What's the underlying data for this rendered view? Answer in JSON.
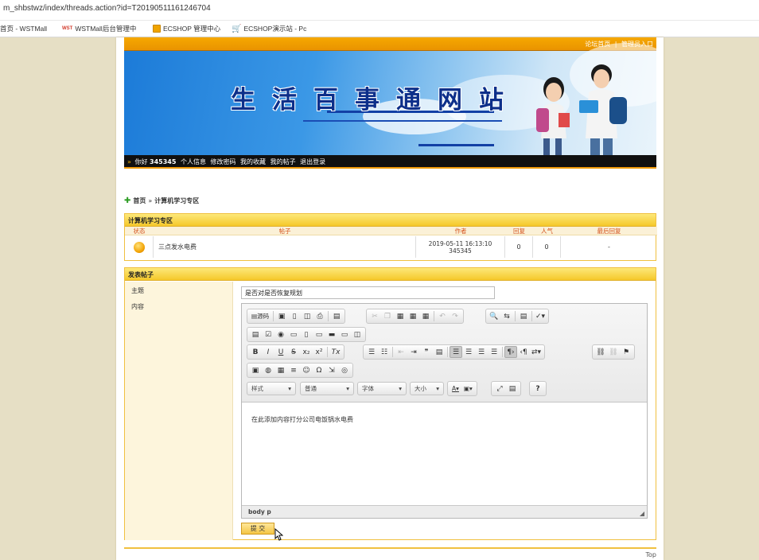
{
  "browser": {
    "url": "m_shbstwz/index/threads.action?id=T20190511161246704",
    "bookmarks": [
      {
        "label": "首页 - WSTMall",
        "icon": "page-icon"
      },
      {
        "label": "WSTMall后台管理中",
        "icon": "wst-logo-icon",
        "badge": "WST"
      },
      {
        "label": "ECSHOP 管理中心",
        "icon": "ecshop-icon"
      },
      {
        "label": "ECSHOP演示站 - Pc",
        "icon": "ecshop-cart-icon"
      }
    ]
  },
  "header": {
    "links": [
      "论坛首页",
      "管理员入口"
    ],
    "link_sep": "|",
    "site_title": "生活百事通网站"
  },
  "userbar": {
    "arrow": "»",
    "greeting": "你好",
    "username": "345345",
    "links": [
      "个人信息",
      "修改密码",
      "我的收藏",
      "我的帖子",
      "退出登录"
    ]
  },
  "breadcrumb": {
    "icon": "plus-icon",
    "home": "首页",
    "sep": "»",
    "current": "计算机学习专区"
  },
  "forum": {
    "title": "计算机学习专区",
    "columns": [
      "状态",
      "帖子",
      "作者",
      "回复",
      "人气",
      "最后回复"
    ],
    "threads": [
      {
        "title": "三点发水电费",
        "date": "2019-05-11 16:13:10",
        "author": "345345",
        "replies": "0",
        "views": "0",
        "last_reply": "-"
      }
    ]
  },
  "post_form": {
    "title": "发表帖子",
    "subject_label": "主题",
    "content_label": "内容",
    "subject_value": "是否对是否恢复规划",
    "toolbar": {
      "source_label": "源码",
      "format_options": {
        "styles": "样式",
        "format": "普通",
        "font": "字体",
        "size": "大小"
      }
    },
    "content_text": "在此添加内容打分公司电饭锅水电费",
    "status_path": "body  p",
    "submit_label": "提 交"
  },
  "footer": {
    "top_link": "Top"
  },
  "colors": {
    "page_bg": "#e6dfc5",
    "header_orange": "#f09a00",
    "section_yellow": "#f5c82a",
    "title_blue": "#0d2f8a",
    "column_red": "#d4531d"
  }
}
